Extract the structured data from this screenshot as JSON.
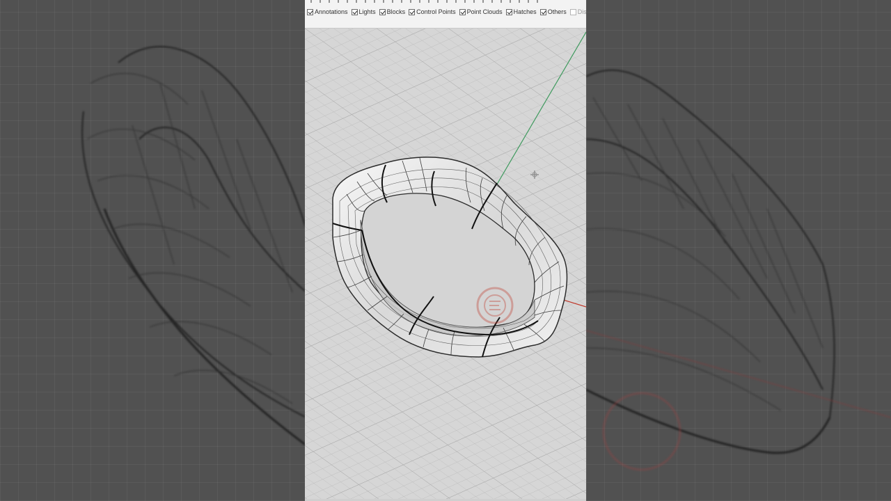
{
  "toolbar": {
    "filters": [
      {
        "label": "Annotations",
        "checked": true
      },
      {
        "label": "Lights",
        "checked": true
      },
      {
        "label": "Blocks",
        "checked": true
      },
      {
        "label": "Control Points",
        "checked": true
      },
      {
        "label": "Point Clouds",
        "checked": true
      },
      {
        "label": "Hatches",
        "checked": true
      },
      {
        "label": "Others",
        "checked": true
      },
      {
        "label": "Disab",
        "checked": false
      }
    ]
  },
  "viewport": {
    "object": "ring-wireframe",
    "grid": true,
    "axis_colors": {
      "x": "#c0392b",
      "y": "#2e8b57"
    },
    "watermark": "logo-stamp"
  },
  "colors": {
    "viewport_bg": "#d6d6d6",
    "toolbar_bg": "#f3f3f3",
    "side_bg": "#515151"
  }
}
